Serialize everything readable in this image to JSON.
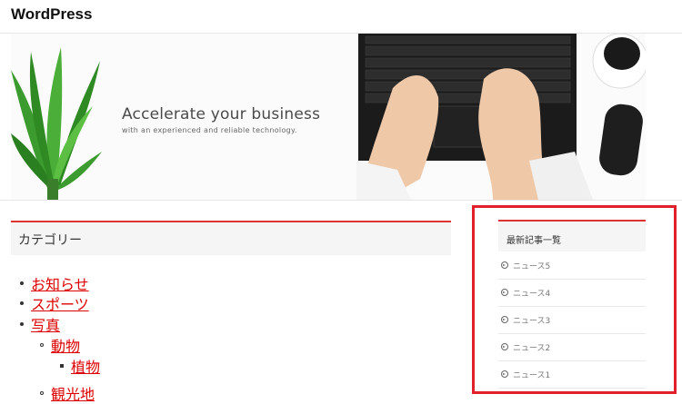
{
  "header": {
    "site_title": "WordPress"
  },
  "hero": {
    "title": "Accelerate your business",
    "subtitle": "with an experienced and reliable technology."
  },
  "categories": {
    "title": "カテゴリー",
    "items": [
      {
        "label": "お知らせ"
      },
      {
        "label": "スポーツ"
      },
      {
        "label": "写真"
      },
      {
        "label": "動物"
      },
      {
        "label": "植物"
      },
      {
        "label": "観光地"
      }
    ]
  },
  "sidebar": {
    "widget_title": "最新記事一覧",
    "posts": [
      {
        "label": "ニュース5"
      },
      {
        "label": "ニュース4"
      },
      {
        "label": "ニュース3"
      },
      {
        "label": "ニュース2"
      },
      {
        "label": "ニュース1"
      }
    ]
  },
  "colors": {
    "accent": "#d33333",
    "link": "#dd0000",
    "highlight_border": "#e0202a"
  }
}
